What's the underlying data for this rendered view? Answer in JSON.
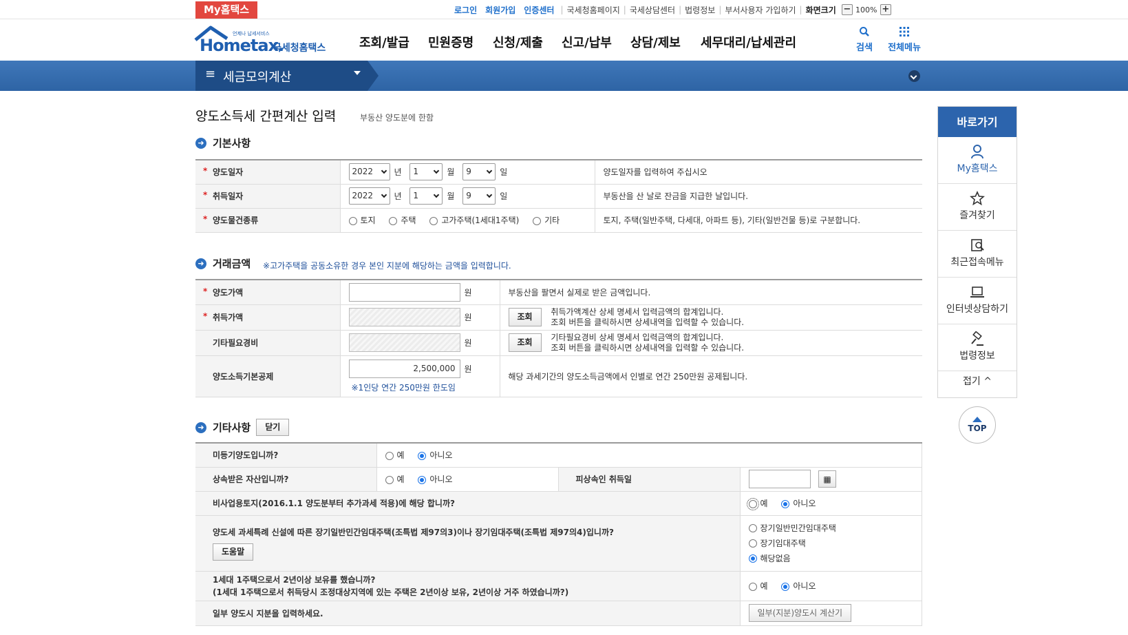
{
  "topbar": {
    "my_hometax": "My홈택스",
    "links_blue": [
      "로그인",
      "회원가입",
      "인증센터"
    ],
    "links_gray": [
      "국세청홈페이지",
      "국세상담센터",
      "법령정보",
      "부서사용자 가입하기"
    ],
    "screen_size_label": "화면크기",
    "zoom_minus": "−",
    "zoom_value": "100%",
    "zoom_plus": "+"
  },
  "header": {
    "logo_small": "언제나 납세서비스",
    "logo_main": "Hometax.",
    "logo_kr": "국세청홈택스",
    "nav": [
      "조회/발급",
      "민원증명",
      "신청/제출",
      "신고/납부",
      "상담/제보",
      "세무대리/납세관리"
    ],
    "search_label": "검색",
    "allmenu_label": "전체메뉴"
  },
  "bluebar": {
    "menu_icon": "≡",
    "menu_title": "세금모의계산"
  },
  "page": {
    "title": "양도소득세 간편계산 입력",
    "subtitle": "부동산 양도분에 한함"
  },
  "basic": {
    "title": "기본사항",
    "rows": [
      {
        "label": "양도일자",
        "year": "2022",
        "month": "1",
        "day": "9",
        "year_unit": "년",
        "month_unit": "월",
        "day_unit": "일",
        "desc": "양도일자를 입력하여 주십시오"
      },
      {
        "label": "취득일자",
        "year": "2022",
        "month": "1",
        "day": "9",
        "year_unit": "년",
        "month_unit": "월",
        "day_unit": "일",
        "desc": "부동산을 산 날로 잔금을 지급한 날입니다."
      }
    ],
    "type_row": {
      "label": "양도물건종류",
      "options": [
        "토지",
        "주택",
        "고가주택(1세대1주택)",
        "기타"
      ],
      "desc": "토지, 주택(일반주택, 다세대, 아파트 등), 기타(일반건물 등)로 구분합니다."
    }
  },
  "amount": {
    "title": "거래금액",
    "note": "고가주택을 공동소유한 경우 본인 지분에 해당하는 금액을 입력합니다.",
    "note_mark": "※",
    "unit": "원",
    "rows": [
      {
        "label": "양도가액",
        "value": "",
        "desc1": "부동산을 팔면서 실제로 받은 금액입니다.",
        "desc2": ""
      },
      {
        "label": "취득가액",
        "value": "",
        "button": "조회",
        "desc1": "취득가액계산 상세 명세서 입력금액의 합계입니다.",
        "desc2": "조회 버튼을 클릭하시면 상세내역을 입력할 수 있습니다."
      },
      {
        "label": "기타필요경비",
        "value": "",
        "button": "조회",
        "desc1": "기타필요경비 상세 명세서 입력금액의 합계입니다.",
        "desc2": "조회 버튼을 클릭하시면 상세내역을 입력할 수 있습니다."
      },
      {
        "label": "양도소득기본공제",
        "value": "2,500,000",
        "subnote": "※1인당 연간 250만원 한도임",
        "desc1": "해당 과세기간의 양도소득금액에서 인별로 연간 250만원 공제됩니다.",
        "desc2": ""
      }
    ]
  },
  "other": {
    "title": "기타사항",
    "close_button": "닫기",
    "yes": "예",
    "no": "아니오",
    "q1": "미등기양도입니까?",
    "q2": "상속받은 자산입니까?",
    "q2_side_label": "피상속인 취득일",
    "q3": "비사업용토지(2016.1.1 양도분부터 추가과세 적용)에 해당 합니까?",
    "q4": "양도세 과세특례 신설에 따른 장기일반민간임대주택(조특법 제97의3)이나 장기임대주택(조특법 제97의4)입니까?",
    "q4_help": "도움말",
    "q4_options": [
      "장기일반민간임대주택",
      "장기임대주택",
      "해당없음"
    ],
    "q5_line1": "1세대 1주택으로서 2년이상 보유를 했습니까?",
    "q5_line2": "(1세대 1주택으로서 취득당시 조정대상지역에 있는 주택은 2년이상 보유, 2년이상 거주 하였습니까?)",
    "q6": "일부 양도시 지분을 입력하세요.",
    "q6_button": "일부(지분)양도시 계산기"
  },
  "quick": {
    "title": "바로가기",
    "items": [
      "My홈택스",
      "즐겨찾기",
      "최근접속메뉴",
      "인터넷상담하기",
      "법령정보"
    ],
    "fold": "접기 ^"
  },
  "top_button": "TOP",
  "colors": {
    "brand_blue": "#2c64ad",
    "my_red": "#e2473f",
    "link_blue": "#1e6fcb"
  }
}
